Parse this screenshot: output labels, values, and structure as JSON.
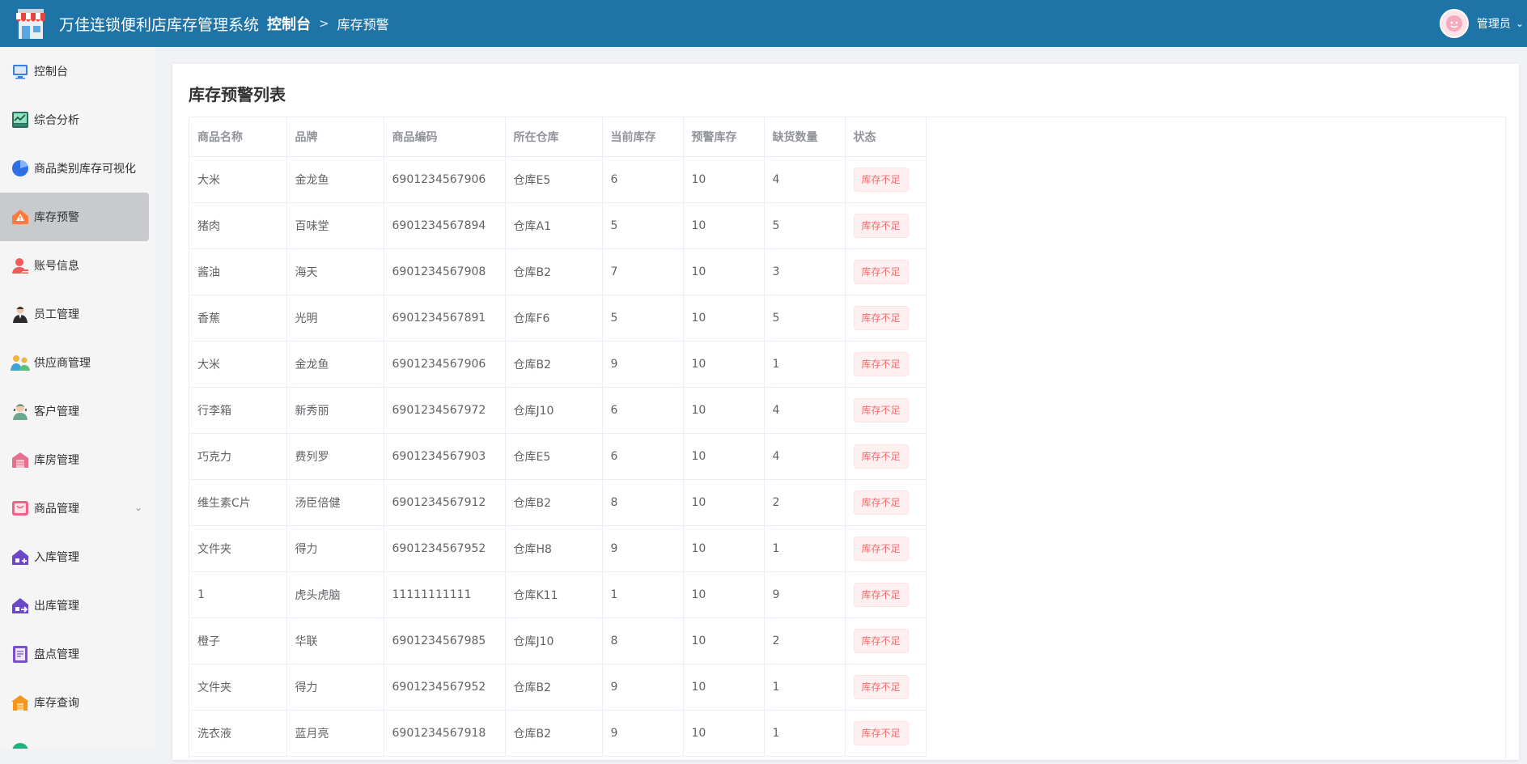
{
  "header": {
    "app_title": "万佳连锁便利店库存管理系统",
    "breadcrumb_main": "控制台",
    "breadcrumb_separator": ">",
    "breadcrumb_current": "库存预警",
    "user_name": "管理员",
    "user_caret": "⌄"
  },
  "sidebar": {
    "items": [
      {
        "label": "控制台",
        "icon": "monitor-icon"
      },
      {
        "label": "综合分析",
        "icon": "analysis-chart-icon"
      },
      {
        "label": "商品类别库存可视化",
        "icon": "pie-chart-icon"
      },
      {
        "label": "库存预警",
        "icon": "warning-house-icon",
        "active": true
      },
      {
        "label": "账号信息",
        "icon": "account-icon"
      },
      {
        "label": "员工管理",
        "icon": "employee-icon"
      },
      {
        "label": "供应商管理",
        "icon": "supplier-icon"
      },
      {
        "label": "客户管理",
        "icon": "customer-icon"
      },
      {
        "label": "库房管理",
        "icon": "warehouse-icon"
      },
      {
        "label": "商品管理",
        "icon": "goods-icon",
        "expandable": true
      },
      {
        "label": "入库管理",
        "icon": "inbound-icon"
      },
      {
        "label": "出库管理",
        "icon": "outbound-icon"
      },
      {
        "label": "盘点管理",
        "icon": "inventory-check-icon"
      },
      {
        "label": "库存查询",
        "icon": "stock-query-icon"
      }
    ],
    "chevron": "⌄"
  },
  "main": {
    "title": "库存预警列表",
    "table": {
      "columns": [
        "商品名称",
        "品牌",
        "商品编码",
        "所在仓库",
        "当前库存",
        "预警库存",
        "缺货数量",
        "状态"
      ],
      "rows": [
        [
          "大米",
          "金龙鱼",
          "6901234567906",
          "仓库E5",
          "6",
          "10",
          "4",
          "库存不足"
        ],
        [
          "猪肉",
          "百味堂",
          "6901234567894",
          "仓库A1",
          "5",
          "10",
          "5",
          "库存不足"
        ],
        [
          "酱油",
          "海天",
          "6901234567908",
          "仓库B2",
          "7",
          "10",
          "3",
          "库存不足"
        ],
        [
          "香蕉",
          "光明",
          "6901234567891",
          "仓库F6",
          "5",
          "10",
          "5",
          "库存不足"
        ],
        [
          "大米",
          "金龙鱼",
          "6901234567906",
          "仓库B2",
          "9",
          "10",
          "1",
          "库存不足"
        ],
        [
          "行李箱",
          "新秀丽",
          "6901234567972",
          "仓库J10",
          "6",
          "10",
          "4",
          "库存不足"
        ],
        [
          "巧克力",
          "费列罗",
          "6901234567903",
          "仓库E5",
          "6",
          "10",
          "4",
          "库存不足"
        ],
        [
          "维生素C片",
          "汤臣倍健",
          "6901234567912",
          "仓库B2",
          "8",
          "10",
          "2",
          "库存不足"
        ],
        [
          "文件夹",
          "得力",
          "6901234567952",
          "仓库H8",
          "9",
          "10",
          "1",
          "库存不足"
        ],
        [
          "1",
          "虎头虎脑",
          "11111111111",
          "仓库K11",
          "1",
          "10",
          "9",
          "库存不足"
        ],
        [
          "橙子",
          "华联",
          "6901234567985",
          "仓库J10",
          "8",
          "10",
          "2",
          "库存不足"
        ],
        [
          "文件夹",
          "得力",
          "6901234567952",
          "仓库B2",
          "9",
          "10",
          "1",
          "库存不足"
        ],
        [
          "洗衣液",
          "蓝月亮",
          "6901234567918",
          "仓库B2",
          "9",
          "10",
          "1",
          "库存不足"
        ]
      ]
    }
  },
  "colors": {
    "header_bg": "#1f74a7",
    "sidebar_bg": "#f5f5f6",
    "active_item_bg": "#c8cacd",
    "tag_text": "#f56c6c",
    "tag_bg": "#fef0f0"
  }
}
